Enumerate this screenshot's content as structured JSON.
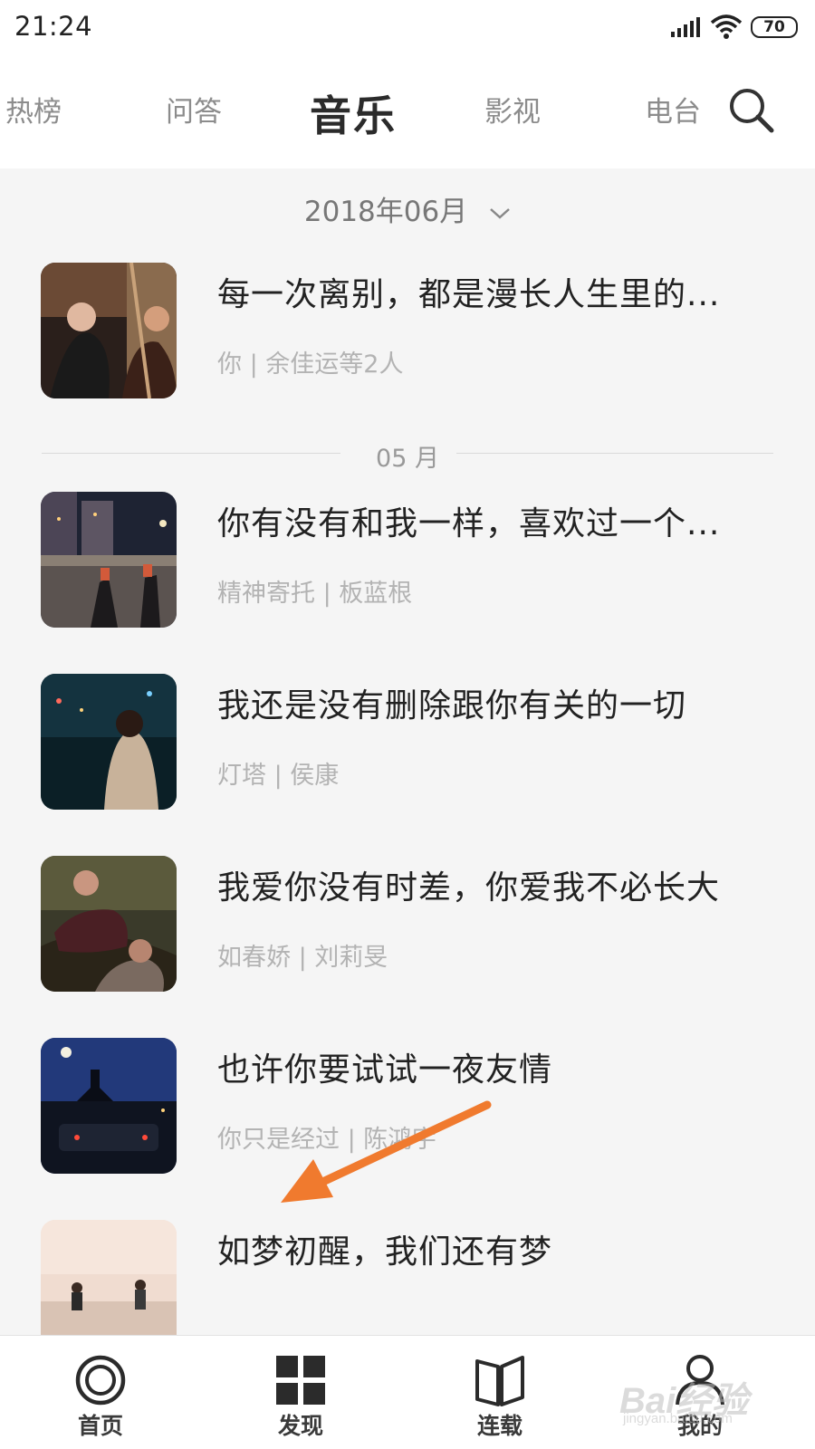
{
  "status_bar": {
    "time": "21:24",
    "battery": "70"
  },
  "nav": {
    "tabs": [
      {
        "label": "热榜",
        "active": false
      },
      {
        "label": "问答",
        "active": false
      },
      {
        "label": "音乐",
        "active": true
      },
      {
        "label": "影视",
        "active": false
      },
      {
        "label": "电台",
        "active": false
      }
    ],
    "search_icon": "search-icon"
  },
  "date_filter": {
    "label": "2018年06月",
    "icon": "chevron-down-icon"
  },
  "feed": {
    "items": [
      {
        "title": "每一次离别，都是漫长人生里的...",
        "meta": "你 | 余佳运等2人"
      },
      {
        "title": "你有没有和我一样，喜欢过一个...",
        "meta": "精神寄托 | 板蓝根"
      },
      {
        "title": "我还是没有删除跟你有关的一切",
        "meta": "灯塔 | 侯康"
      },
      {
        "title": "我爱你没有时差，你爱我不必长大",
        "meta": "如春娇 | 刘莉旻"
      },
      {
        "title": "也许你要试试一夜友情",
        "meta": "你只是经过 | 陈鸿宇"
      },
      {
        "title": "如梦初醒，我们还有梦",
        "meta": ""
      }
    ],
    "month_divider": "05 月"
  },
  "annotation": {
    "color": "#f07a2e"
  },
  "bottom_nav": {
    "tabs": [
      {
        "label": "首页",
        "icon": "home-ring-icon"
      },
      {
        "label": "发现",
        "icon": "grid-icon"
      },
      {
        "label": "连载",
        "icon": "book-icon"
      },
      {
        "label": "我的",
        "icon": "user-icon"
      }
    ]
  },
  "watermark": {
    "main": "Bai经验",
    "sub": "jingyan.baidu.com"
  }
}
